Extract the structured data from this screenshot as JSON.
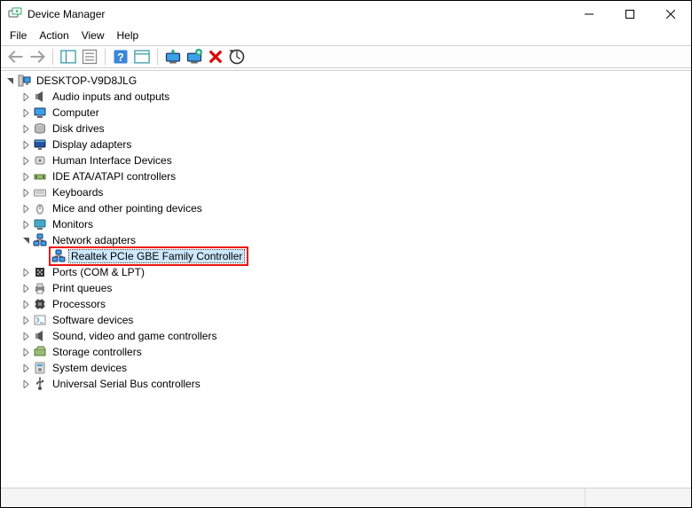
{
  "title": "Device Manager",
  "menu": {
    "file": "File",
    "action": "Action",
    "view": "View",
    "help": "Help"
  },
  "root": "DESKTOP-V9D8JLG",
  "categories": [
    {
      "name": "Audio inputs and outputs",
      "icon": "speaker"
    },
    {
      "name": "Computer",
      "icon": "computer"
    },
    {
      "name": "Disk drives",
      "icon": "disk"
    },
    {
      "name": "Display adapters",
      "icon": "display"
    },
    {
      "name": "Human Interface Devices",
      "icon": "hid"
    },
    {
      "name": "IDE ATA/ATAPI controllers",
      "icon": "ide"
    },
    {
      "name": "Keyboards",
      "icon": "keyboard"
    },
    {
      "name": "Mice and other pointing devices",
      "icon": "mouse"
    },
    {
      "name": "Monitors",
      "icon": "monitor"
    },
    {
      "name": "Network adapters",
      "icon": "network",
      "expanded": true,
      "children": [
        {
          "name": "Realtek PCIe GBE Family Controller",
          "icon": "network",
          "selected": true,
          "highlighted": true
        }
      ]
    },
    {
      "name": "Ports (COM & LPT)",
      "icon": "port"
    },
    {
      "name": "Print queues",
      "icon": "printer"
    },
    {
      "name": "Processors",
      "icon": "cpu"
    },
    {
      "name": "Software devices",
      "icon": "software"
    },
    {
      "name": "Sound, video and game controllers",
      "icon": "speaker"
    },
    {
      "name": "Storage controllers",
      "icon": "storage"
    },
    {
      "name": "System devices",
      "icon": "system"
    },
    {
      "name": "Universal Serial Bus controllers",
      "icon": "usb"
    }
  ]
}
